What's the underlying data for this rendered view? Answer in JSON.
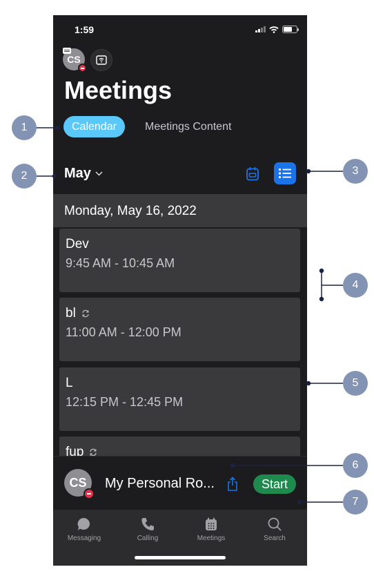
{
  "status_bar": {
    "time": "1:59"
  },
  "header": {
    "avatar_initials": "CS",
    "title": "Meetings"
  },
  "tabs": {
    "calendar": "Calendar",
    "meetings_content": "Meetings Content"
  },
  "month_picker": {
    "label": "May"
  },
  "day_header": "Monday, May 16, 2022",
  "meetings": [
    {
      "name": "Dev",
      "time": "9:45 AM - 10:45 AM",
      "recurring": false
    },
    {
      "name": "bl",
      "time": "11:00 AM - 12:00 PM",
      "recurring": true
    },
    {
      "name": "L",
      "time": "12:15 PM - 12:45 PM",
      "recurring": false
    },
    {
      "name": "fup",
      "time": "",
      "recurring": true
    }
  ],
  "personal_room": {
    "avatar_initials": "CS",
    "name": "My Personal Ro...",
    "start_label": "Start"
  },
  "tabbar": [
    {
      "label": "Messaging",
      "icon": "message-icon"
    },
    {
      "label": "Calling",
      "icon": "phone-icon"
    },
    {
      "label": "Meetings",
      "icon": "calendar-icon"
    },
    {
      "label": "Search",
      "icon": "search-icon"
    }
  ],
  "callouts": [
    "1",
    "2",
    "3",
    "4",
    "5",
    "6",
    "7"
  ],
  "colors": {
    "background": "#1c1c1e",
    "accent_blue": "#1a73e8",
    "calendar_pill": "#5ac8fa",
    "start_green": "#1e8a4e",
    "presence_red": "#e0344c",
    "callout": "#8393b3"
  }
}
